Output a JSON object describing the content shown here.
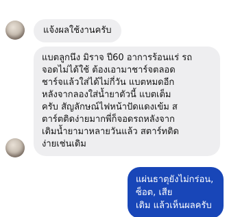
{
  "conversation": {
    "messages": [
      {
        "sender": "incoming",
        "text": "แจ้งผลใช้งานครับ"
      },
      {
        "sender": "incoming",
        "text": "แบตลูกนึง มิราจ ปี60 อาการร้อนแร่ รถ\nจอดไม่ได้ใช้ ต้องเอามาชาร์จตลอด\nชาร์จแล้วใส่ได้ไม่กี่วัน แบตหมดอีก\nหลังจากลองใส่น้ำยาตัวนี้ แบตเต็ม\nครับ สัญลักษณ์ไฟหน้าปัดแดงเข้ม ส\nตาร์ตติดง่ายมากพี่ก็จอดรถหลังจาก\nเติมน้ำยามาหลายวันแล้ว สตาร์ทติด\nง่ายเช่นเดิม"
      },
      {
        "sender": "outgoing",
        "text": "แผ่นธาตุยังไม่กร่อน, ซ็อต, เสีย\nเติม แล้วเห็นผลครับ"
      }
    ]
  },
  "colors": {
    "incoming_bubble": "#eeeef0",
    "outgoing_bubble": "#1846b8"
  }
}
